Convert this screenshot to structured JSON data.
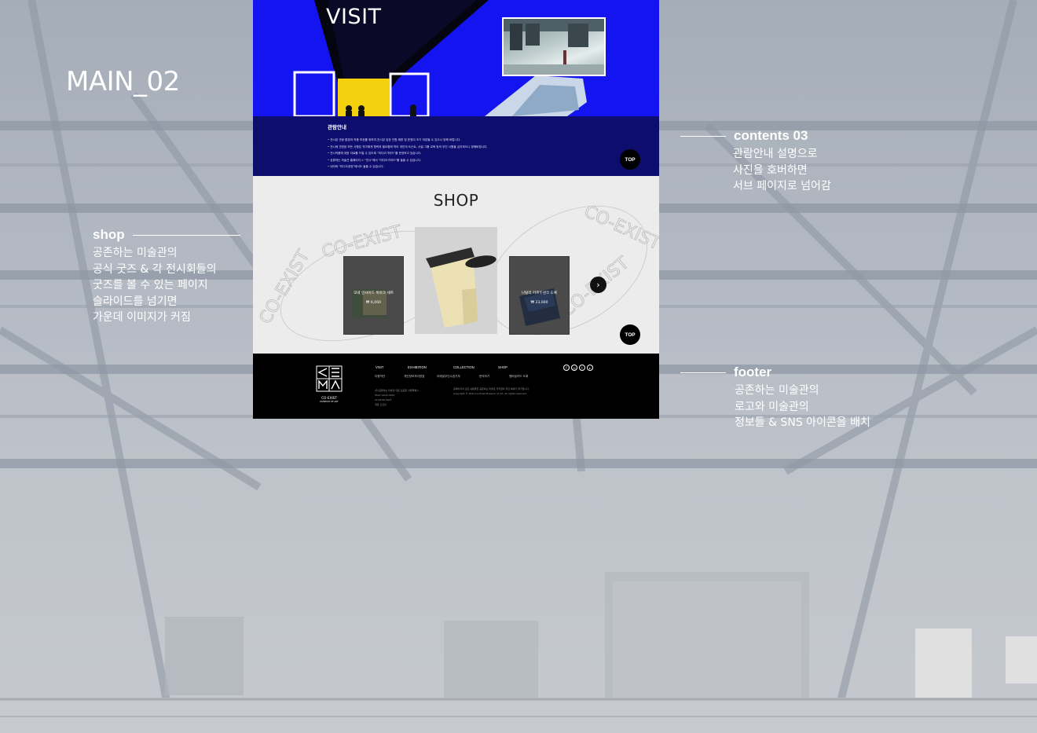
{
  "page_label": "MAIN_02",
  "annotations": {
    "contents": {
      "heading": "contents 03",
      "lines": [
        "관람안내 설명으로",
        "사진을 호버하면",
        "서브 페이지로 넘어감"
      ]
    },
    "shop": {
      "heading": "shop",
      "lines": [
        "공존하는 미술관의",
        "공식 굿즈 & 각 전시회들의",
        "굿즈를 볼 수 있는 페이지",
        "슬라이드를 넘기면",
        "가운데 이미지가 커짐"
      ]
    },
    "footer": {
      "heading": "footer",
      "lines": [
        "공존하는 미술관의",
        "로고와 미술관의",
        "정보들 & SNS 아이콘을 배치"
      ]
    }
  },
  "site": {
    "visit": {
      "title": "VISIT",
      "info_heading": "관람안내",
      "info_lines": [
        "• 전시된 관람 환경과 작품 보호를 위하여 전시장 입장 인원 제한 및 운영이 조기 마감될 수 있으니 양해 바랍니다.",
        "• 전시에 관련된 모든 사항은 작가에게 협력과 필요함에 따라 개인의 도슨트, 사설 그룹 교육 등의 무단 사활을 금지하오니 양해바랍니다.",
        "• 전시작품에 대한 자료를 드릴 수 있도록 \"미디오가이드\"를 운영하고 있습니다.",
        "• 공휴하는 미술관 홈페이지 > \"전시\"에서 \"미디오가이드\"를 들을 수 있습니다.",
        "• 네이버 \"미디오공방\"에서도 들을 수 있습니다."
      ],
      "top_label": "TOP"
    },
    "shop": {
      "title": "SHOP",
      "watermark": "CO-EXIST",
      "products": [
        {
          "name": "모네 인사이드 북마크 세트",
          "price": "₩ 6,000"
        },
        {
          "name": "나탈리 카르두넨코 도록",
          "price": "₩ 23,000"
        }
      ],
      "next_icon": "chevron-right-icon",
      "top_label": "TOP"
    },
    "footer": {
      "logo_letters": "C E M A",
      "logo_name": "CO-EXIST",
      "logo_sub": "MUSEUM OF ART",
      "nav": [
        "VISIT",
        "EXHIBITION",
        "COLLECTION",
        "SHOP"
      ],
      "links": [
        "이용약관",
        "개인정보처리방침",
        "이메일무단수집거부",
        "문의하기",
        "멤버쉽카드 도록"
      ],
      "info_left": [
        "(주)공존하는 미술관 대표 김공존 서울특별시 ...",
        "0507-1404-1903",
        "02-6236-1903",
        "개장 오프닝"
      ],
      "info_right": [
        "홈페이지의 모든 내용물은 공존하는 미술관 저작권의 무단 복제가 불가합니다.",
        "Copyright © 2021 Co-Exist Museum of Art. All rights reserved."
      ],
      "sns": [
        "facebook-icon",
        "instagram-icon",
        "twitter-icon",
        "youtube-icon"
      ]
    }
  },
  "colors": {
    "visit_blue": "#1414f0",
    "info_navy": "#0d0d6e",
    "shop_bg": "#ececec",
    "footer_bg": "#000000"
  }
}
